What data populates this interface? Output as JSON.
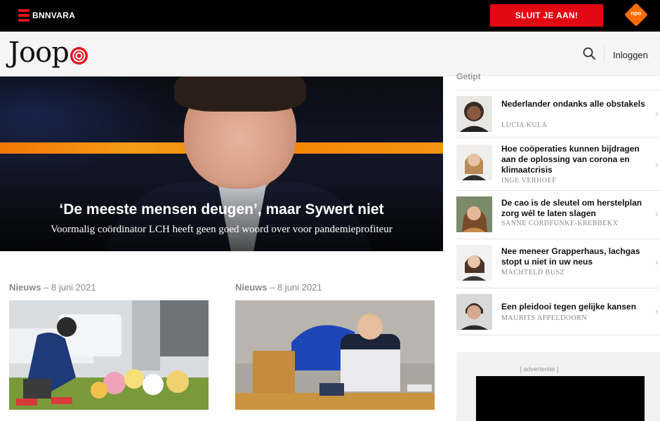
{
  "brand": {
    "name": "BNNVARA",
    "site_logo": "Joop",
    "npo": "npo"
  },
  "topbar": {
    "join_label": "SLUIT JE AAN!"
  },
  "header": {
    "login_label": "Inloggen",
    "search_icon": "search-icon"
  },
  "hero": {
    "title": "‘De meeste mensen deugen’, maar Sywert niet",
    "subtitle": "Voormalig coördinator LCH heeft geen goed woord over voor pandemieprofiteur"
  },
  "cards": [
    {
      "category": "Nieuws",
      "date": "8 juni 2021"
    },
    {
      "category": "Nieuws",
      "date": "8 juni 2021"
    }
  ],
  "sidebar": {
    "heading": "Getipt",
    "items": [
      {
        "title": "Nederlander ondanks alle obstakels",
        "author": "LUCIA KULA"
      },
      {
        "title": "Hoe coöperaties kunnen bijdragen aan de oplossing van corona en klimaatcrisis",
        "author": "INGE VERHOEF"
      },
      {
        "title": "De cao is de sleutel om herstelplan zorg wél te laten slagen",
        "author": "SANNE CORDFUNKE-KREBBEKX"
      },
      {
        "title": "Nee meneer Grapperhaus, lachgas stopt u niet in uw neus",
        "author": "MACHTELD BUSZ"
      },
      {
        "title": "Een pleidooi tegen gelijke kansen",
        "author": "MAURITS APPELDOORN"
      }
    ]
  },
  "ad": {
    "label": "[ advertentie ]"
  },
  "colors": {
    "accent": "#e30613",
    "npo_orange": "#ff6d00",
    "topbar": "#000000"
  }
}
